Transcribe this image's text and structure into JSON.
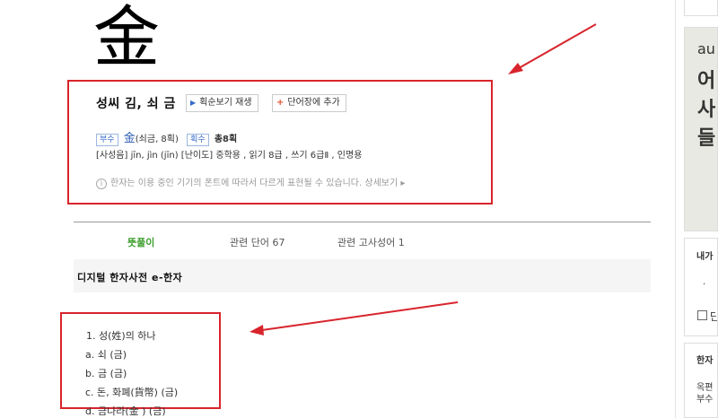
{
  "hanja": {
    "character": "金"
  },
  "info": {
    "reading": "성씨 김, 쇠 금",
    "stroke_button": "획순보기 재생",
    "vocab_button": "단어장에 추가",
    "radical_tag": "부수",
    "radical_char": "金",
    "radical_desc": "(쇠금, 8획)",
    "strokes_tag": "획수",
    "strokes_value": "총8획",
    "pronunciation": "[사성음] jīn, jìn (jīn)",
    "difficulty": "[난이도] 중학용 , 읽기 8급 , 쓰기 6급Ⅱ , 인명용",
    "notice_icon": "i",
    "notice": "한자는 이용 중인 기기의 폰트에 따라서 다르게 표현될 수 있습니다. 상세보기 ▸"
  },
  "tabs": [
    {
      "label": "뜻풀이"
    },
    {
      "label": "관련 단어 67"
    },
    {
      "label": "관련 고사성어 1"
    }
  ],
  "dictionary": {
    "title": "디지털 한자사전 e-한자"
  },
  "meanings": [
    {
      "text": "1. 성(姓)의 하나"
    },
    {
      "text": "a. 쇠 (금)"
    },
    {
      "text": "b. 금 (금)"
    },
    {
      "text": "c. 돈, 화폐(貨幣) (금)"
    },
    {
      "text": "d. 금나라(金   ) (금)"
    }
  ],
  "sidebar": {
    "ad_brand": "au",
    "ad_lines": [
      "어",
      "사",
      "들"
    ],
    "panel1_title": "내가",
    "panel1_item": "·",
    "panel1_check_label": "단",
    "panel2_title": "한자",
    "panel2_line1": "옥편",
    "panel2_line2": "부수"
  },
  "colors": {
    "highlight_box": "#d8242c",
    "active_tab": "#3a9d2a",
    "link_blue": "#3569c8"
  }
}
